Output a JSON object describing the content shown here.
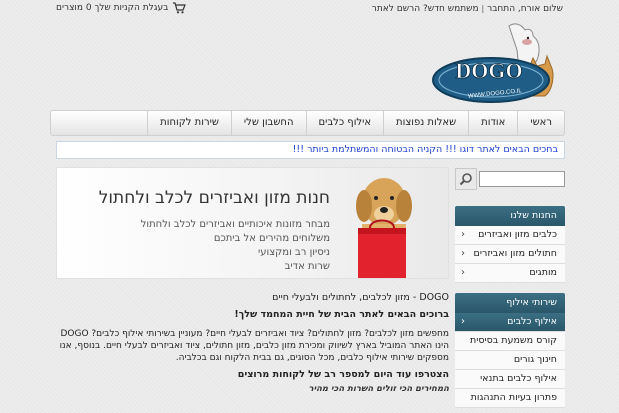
{
  "topbar": {
    "greeting": "שלום אורח, התחבר",
    "separator": "|",
    "new_user": "משתמש חדש? הרשם לאתר",
    "cart_label": "בעגלת הקניות שלך 0 מוצרים"
  },
  "logo": {
    "brand": "DOGO",
    "url": "WWW.DOGO.CO.IL"
  },
  "nav": [
    "ראשי",
    "אודות",
    "שאלות נפוצות",
    "אילוף כלבים",
    "החשבון שלי",
    "שירות לקוחות"
  ],
  "notice": "בחכים הבאים לאתר דוגו !!! הקניה הבטוחה והמשתלמת ביותר !!!",
  "search": {
    "placeholder": ""
  },
  "sidebar": {
    "shop_title": "החנות שלנו",
    "shop_items": [
      "כלבים מזון ואביזרים",
      "חתולים מזון ואביזרים",
      "מותגים"
    ],
    "training_title": "שירותי אילוף",
    "training_items": [
      "אילוף כלבים",
      "קורס משמעת בסיסית",
      "חינוך גורים",
      "אילוף כלבים בתנאי פונזיון",
      "פתרון בעיות התנהגות"
    ]
  },
  "banner": {
    "title": "חנות מזון ואביזרים לכלב ולחתול",
    "lines": [
      "מבחר מזונות איכותיים ואביזרים לכלב ולחתול",
      "משלוחים מהירים אל ביתכם",
      "ניסיון רב ומקצועי",
      "שרות אדיב"
    ]
  },
  "content": {
    "title": "DOGO - מזון לכלבים, לחתולים ולבעלי חיים",
    "welcome": "ברוכים הבאים לאתר הבית של חיית המחמד שלך!",
    "para1": "מחפשים מזון לכלבים? מזון לחתולים? ציוד ואביזרים לבעלי חיים? מעוניין בשירותי אילוף כלבים? DOGO הינו האתר המוביל בארץ לשיווק ומכירת מזון כלבים, מזון חתולים, ציוד ואביזרים לבעלי חיים. בנוסף, אנו מספקים שירותי אילוף כלבים, מכל הסוגים, גם בבית הלקוח וגם בכלביה.",
    "join": "הצטרפו עוד היום למספר רב של לקוחות מרוצים",
    "tagline": "המחירים הכי זולים השרות הכי מהיר"
  }
}
